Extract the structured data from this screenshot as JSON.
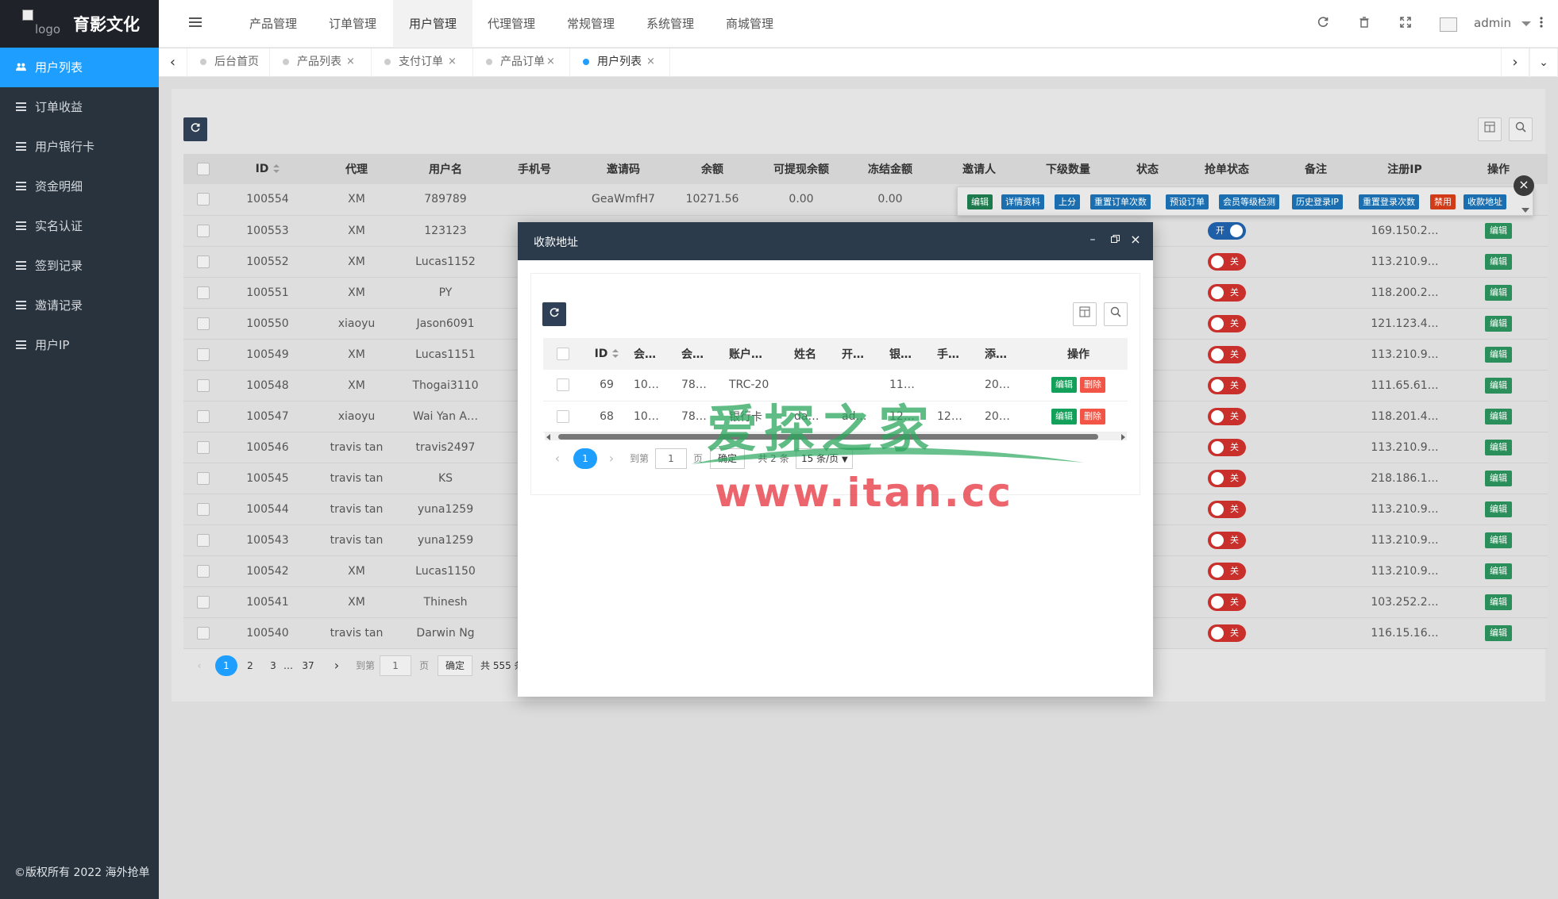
{
  "brand": {
    "title": "育影文化",
    "logo_alt": "logo"
  },
  "sidebar": {
    "items": [
      {
        "label": "用户列表"
      },
      {
        "label": "订单收益"
      },
      {
        "label": "用户银行卡"
      },
      {
        "label": "资金明细"
      },
      {
        "label": "实名认证"
      },
      {
        "label": "签到记录"
      },
      {
        "label": "邀请记录"
      },
      {
        "label": "用户IP"
      }
    ],
    "copyright": "©版权所有 2022 海外抢单"
  },
  "topnav": {
    "items": [
      {
        "label": "产品管理"
      },
      {
        "label": "订单管理"
      },
      {
        "label": "用户管理"
      },
      {
        "label": "代理管理"
      },
      {
        "label": "常规管理"
      },
      {
        "label": "系统管理"
      },
      {
        "label": "商城管理"
      }
    ],
    "user": "admin"
  },
  "tabs": [
    {
      "label": "后台首页"
    },
    {
      "label": "产品列表"
    },
    {
      "label": "支付订单"
    },
    {
      "label": "产品订单"
    },
    {
      "label": "用户列表"
    }
  ],
  "table": {
    "headers": [
      "ID",
      "代理",
      "用户名",
      "手机号",
      "邀请码",
      "余额",
      "可提现余额",
      "冻结金额",
      "邀请人",
      "下级数量",
      "状态",
      "抢单状态",
      "备注",
      "注册IP",
      "操作"
    ],
    "first_row": {
      "id": "100554",
      "agent": "XM",
      "username": "789789",
      "phone": "",
      "invite_code": "GeaWmfH7",
      "balance": "10271.56",
      "withdrawable": "0.00",
      "frozen": "0.00"
    },
    "rows": [
      {
        "id": "100553",
        "agent": "XM",
        "username": "123123",
        "grab": "开",
        "ip": "169.150.2…",
        "op": "编辑"
      },
      {
        "id": "100552",
        "agent": "XM",
        "username": "Lucas1152",
        "grab": "关",
        "ip": "113.210.9…",
        "op": "编辑"
      },
      {
        "id": "100551",
        "agent": "XM",
        "username": "PY",
        "grab": "关",
        "ip": "118.200.2…",
        "op": "编辑"
      },
      {
        "id": "100550",
        "agent": "xiaoyu",
        "username": "Jason6091",
        "grab": "关",
        "ip": "121.123.4…",
        "op": "编辑"
      },
      {
        "id": "100549",
        "agent": "XM",
        "username": "Lucas1151",
        "grab": "关",
        "ip": "113.210.9…",
        "op": "编辑"
      },
      {
        "id": "100548",
        "agent": "XM",
        "username": "Thogai3110",
        "grab": "关",
        "ip": "111.65.61…",
        "op": "编辑"
      },
      {
        "id": "100547",
        "agent": "xiaoyu",
        "username": "Wai Yan A…",
        "grab": "关",
        "ip": "118.201.4…",
        "op": "编辑"
      },
      {
        "id": "100546",
        "agent": "travis tan",
        "username": "travis2497",
        "grab": "关",
        "ip": "113.210.9…",
        "op": "编辑"
      },
      {
        "id": "100545",
        "agent": "travis tan",
        "username": "KS",
        "grab": "关",
        "ip": "218.186.1…",
        "op": "编辑"
      },
      {
        "id": "100544",
        "agent": "travis tan",
        "username": "yuna1259",
        "grab": "关",
        "ip": "113.210.9…",
        "op": "编辑"
      },
      {
        "id": "100543",
        "agent": "travis tan",
        "username": "yuna1259",
        "grab": "关",
        "ip": "113.210.9…",
        "op": "编辑"
      },
      {
        "id": "100542",
        "agent": "XM",
        "username": "Lucas1150",
        "grab": "关",
        "ip": "113.210.9…",
        "op": "编辑"
      },
      {
        "id": "100541",
        "agent": "XM",
        "username": "Thinesh",
        "grab": "关",
        "ip": "103.252.2…",
        "op": "编辑"
      },
      {
        "id": "100540",
        "agent": "travis tan",
        "username": "Darwin Ng",
        "grab": "关",
        "ip": "116.15.16…",
        "op": "编辑"
      }
    ],
    "row_ops": [
      "编辑",
      "详情资料",
      "上分",
      "重置订单次数",
      "预设订单",
      "会员等级检测",
      "历史登录IP",
      "重置登录次数",
      "禁用",
      "收款地址"
    ]
  },
  "pager": {
    "pages": [
      "1",
      "2",
      "3",
      "…",
      "37"
    ],
    "goto": "到第",
    "page_value": "1",
    "page_unit": "页",
    "confirm": "确定",
    "total": "共 555 条"
  },
  "modal": {
    "title": "收款地址",
    "headers": [
      "ID",
      "会…",
      "会…",
      "账户…",
      "姓名",
      "开…",
      "银…",
      "手…",
      "添…",
      "操作"
    ],
    "rows": [
      {
        "id": "69",
        "c1": "10…",
        "c2": "78…",
        "c3": "TRC-20",
        "c4": "",
        "c5": "",
        "c6": "11…",
        "c7": "",
        "c8": "20…"
      },
      {
        "id": "68",
        "c1": "10…",
        "c2": "78…",
        "c3": "银行卡",
        "c4": "da…",
        "c5": "ad…",
        "c6": "12…",
        "c7": "12…",
        "c8": "20…"
      }
    ],
    "edit": "编辑",
    "delete": "删除",
    "pager": {
      "page": "1",
      "goto": "到第",
      "page_value": "1",
      "page_unit": "页",
      "confirm": "确定",
      "total": "共 2 条",
      "per_page": "15 条/页"
    }
  },
  "watermark": {
    "cn": "爱探之家",
    "en": "www.itan.cc"
  }
}
